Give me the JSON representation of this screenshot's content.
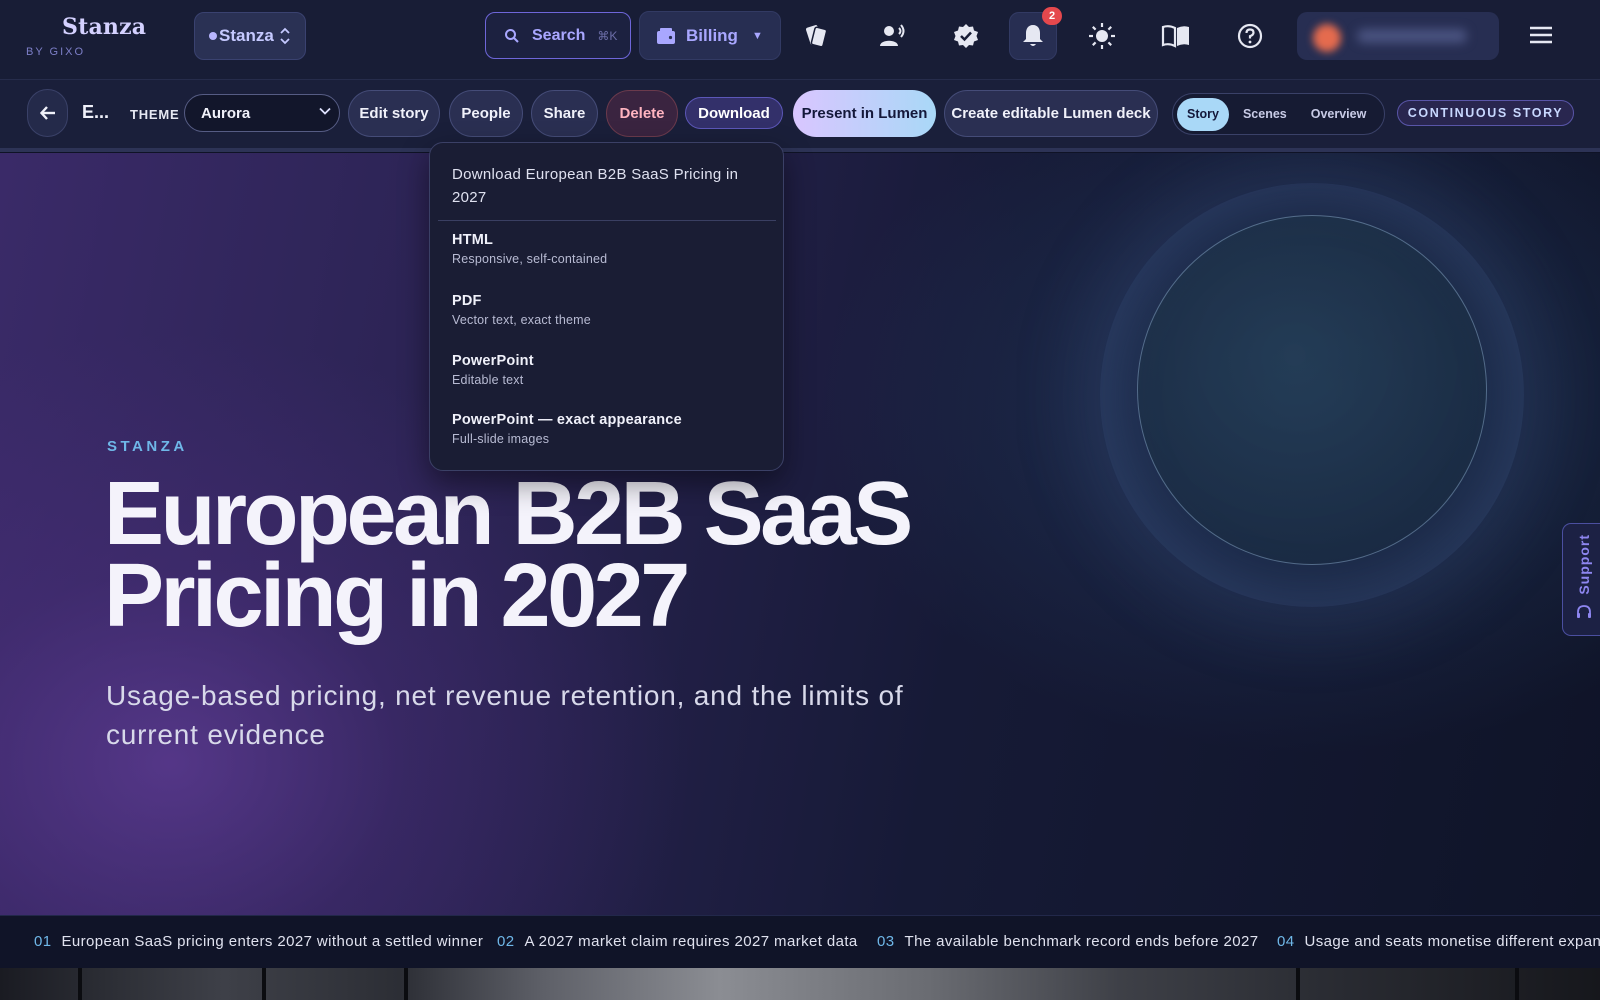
{
  "topnav": {
    "brand": "Stanza",
    "brand_sub": "BY GIXO",
    "workspace": "Stanza",
    "search_label": "Search",
    "search_shortcut": "⌘K",
    "billing_label": "Billing",
    "notifications_count": "2",
    "icons": [
      "cards-icon",
      "voice-icon",
      "verified-icon",
      "bell-icon",
      "sun-icon",
      "book-icon",
      "help-icon",
      "menu-icon"
    ]
  },
  "toolbar": {
    "story_title_short": "E...",
    "theme_label": "THEME",
    "theme_value": "Aurora",
    "buttons": {
      "edit": "Edit story",
      "people": "People",
      "share": "Share",
      "delete": "Delete",
      "download": "Download",
      "present": "Present in Lumen",
      "create_deck": "Create editable Lumen deck"
    },
    "view_tabs": [
      "Story",
      "Scenes",
      "Overview"
    ],
    "active_view": "Story",
    "mode_badge": "CONTINUOUS STORY"
  },
  "dropdown": {
    "heading": "Download European B2B SaaS Pricing in 2027",
    "items": [
      {
        "title": "HTML",
        "desc": "Responsive, self-contained"
      },
      {
        "title": "PDF",
        "desc": "Vector text, exact theme"
      },
      {
        "title": "PowerPoint",
        "desc": "Editable text"
      },
      {
        "title": "PowerPoint — exact appearance",
        "desc": "Full-slide images"
      }
    ]
  },
  "hero": {
    "eyebrow": "STANZA",
    "title_line1": "European B2B SaaS",
    "title_line2": "Pricing in 2027",
    "subtitle": "Usage-based pricing, net revenue retention, and the limits of current evidence"
  },
  "support": {
    "label": "Support"
  },
  "chapters": [
    {
      "num": "01",
      "title": "European SaaS pricing enters 2027 without a settled winner"
    },
    {
      "num": "02",
      "title": "A 2027 market claim requires 2027 market data"
    },
    {
      "num": "03",
      "title": "The available benchmark record ends before 2027"
    },
    {
      "num": "04",
      "title": "Usage and seats monetise different expansion paths"
    }
  ],
  "colors": {
    "accent": "#a9a7ff",
    "eyebrow": "#6fb7e8",
    "badge": "#e5484d",
    "present_gradient_start": "#d9c6ff",
    "present_gradient_end": "#a9d8f7"
  }
}
